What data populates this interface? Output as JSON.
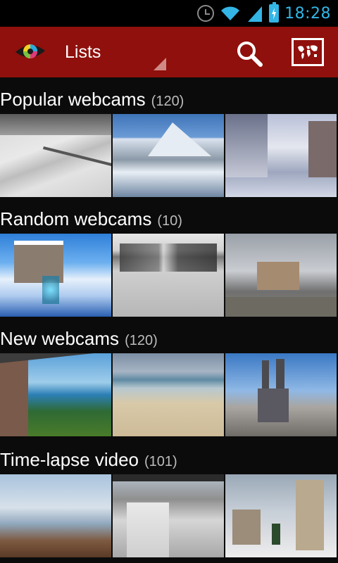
{
  "status_bar": {
    "time": "18:28",
    "icons": [
      "alarm-clock-icon",
      "wifi-icon",
      "signal-icon",
      "battery-charging-icon"
    ],
    "accent_color": "#33b5e5"
  },
  "action_bar": {
    "background_color": "#8f100c",
    "logo": "eye-logo-icon",
    "spinner_label": "Lists",
    "actions": [
      "search-icon",
      "world-map-icon"
    ]
  },
  "sections": [
    {
      "name": "Popular webcams",
      "count": "(120)",
      "thumbs": [
        "snowy hillside with fence",
        "snowy mountain peak",
        "snowy village street"
      ]
    },
    {
      "name": "Random webcams",
      "count": "(10)",
      "thumbs": [
        "snowy rooftop with antenna",
        "ski slope",
        "apartment block under gray sky"
      ]
    },
    {
      "name": "New webcams",
      "count": "(120)",
      "thumbs": [
        "bay with boats",
        "sandy beach",
        "cathedral towers over city"
      ]
    },
    {
      "name": "Time-lapse video",
      "count": "(101)",
      "thumbs": [
        "coastal town at dusk",
        "snowy city street",
        "snowy church square"
      ]
    }
  ]
}
